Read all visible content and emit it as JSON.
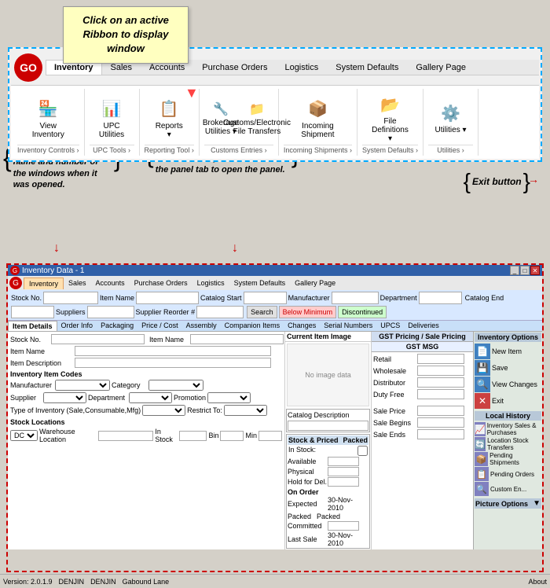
{
  "tooltip": {
    "text": "Click on an active Ribbon to display window"
  },
  "ribbon": {
    "tabs": [
      "Inventory",
      "Sales",
      "Accounts",
      "Purchase Orders",
      "Logistics",
      "System Defaults",
      "Gallery Page"
    ],
    "active_tab": "Inventory",
    "groups": [
      {
        "label": "Inventory Controls",
        "buttons": [
          {
            "label": "View Inventory",
            "icon": "🏪"
          }
        ]
      },
      {
        "label": "UPC Tools",
        "buttons": [
          {
            "label": "UPC Utilities",
            "icon": "📊"
          }
        ]
      },
      {
        "label": "Reporting Tool",
        "buttons": [
          {
            "label": "Reports ▾",
            "icon": "📋"
          }
        ]
      },
      {
        "label": "Customs Entries",
        "buttons": [
          {
            "label": "Brokerage Utilities ▾",
            "icon": "🔧"
          },
          {
            "label": "Customs/Electronic File Transfers",
            "icon": "📁"
          }
        ]
      },
      {
        "label": "Incoming Shipments",
        "buttons": [
          {
            "label": "Incoming Shipment",
            "icon": "📦"
          }
        ]
      },
      {
        "label": "System Defaults",
        "buttons": [
          {
            "label": "File Definitions ▾",
            "icon": "📂"
          }
        ]
      },
      {
        "label": "Utilities",
        "buttons": [
          {
            "label": "Utilities ▾",
            "icon": "⚙️"
          }
        ]
      }
    ]
  },
  "annotations": {
    "left": "Windows displays the name and number of the windows when it was opened.",
    "middle": "Panel – All of the panels are hidden. Place your cursor on the panel tab to open the panel.",
    "right": "Exit button"
  },
  "main_window": {
    "title": "Inventory Data - 1",
    "ribbon_tabs": [
      "Inventory",
      "Sales",
      "Accounts",
      "Purchase Orders",
      "Logistics",
      "System Defaults",
      "Gallery Page"
    ],
    "active_ribbon_tab": "Inventory",
    "search_fields": [
      {
        "label": "Stock No.",
        "value": ""
      },
      {
        "label": "Item Name",
        "value": ""
      },
      {
        "label": "Catalog Start",
        "value": ""
      },
      {
        "label": "Manufacturer",
        "value": ""
      },
      {
        "label": "Department",
        "value": ""
      },
      {
        "label": "Catalog End",
        "value": ""
      },
      {
        "label": "Suppliers",
        "value": ""
      },
      {
        "label": "Supplier Reorder #",
        "value": ""
      }
    ],
    "panel_tabs": [
      "Item Details",
      "Order Info",
      "Packaging",
      "Price / Cost",
      "Assembly",
      "Companion Items",
      "Changes",
      "Serial Numbers",
      "UPCS",
      "Deliveries"
    ],
    "active_panel_tab": "Item Details",
    "form_fields": {
      "stock_no": "",
      "item_name": "",
      "item_description": "",
      "manufacturer": "",
      "category": "",
      "supplier": "",
      "department": "",
      "promotion": "",
      "type_of_inventory": "Sale,Consumable,Mfg",
      "restrict_to": "",
      "stock_locations": {
        "dc": "DC",
        "warehouse_location": "",
        "in_stock": "",
        "bin": "",
        "min": ""
      }
    },
    "image_section": {
      "placeholder": "No image data",
      "catalog_description": "Catalog Description"
    },
    "stock_info": {
      "header": "Stock & Price",
      "packed_label": "Packed",
      "in_stock": "In Stock:",
      "available": "Available",
      "physical": "Physical",
      "hold_for_del": "Hold for Del.",
      "on_order": "On Order",
      "expected": "Expected",
      "expected_date": "30-Nov-2010",
      "packed_field": "Packed",
      "committed": "Committed",
      "last_sale": "Last Sale",
      "last_sale_date": "30-Nov-2010"
    },
    "gst_pricing": {
      "header": "GST Pricing / Sale Pricing",
      "subheader": "GST MSG",
      "fields": [
        "Retail",
        "Wholesale",
        "Distributor",
        "Duty Free",
        "Sale Price",
        "Sale Begins",
        "Sale Ends"
      ]
    },
    "sidebar_inventory": {
      "label": "Inventory Options",
      "buttons": [
        {
          "label": "New Item",
          "icon": "📄",
          "color": "#4080c0"
        },
        {
          "label": "Save",
          "icon": "💾",
          "color": "#4080c0"
        },
        {
          "label": "View Changes",
          "icon": "🔍",
          "color": "#4080c0"
        },
        {
          "label": "Exit",
          "icon": "❌",
          "color": "#cc0000"
        }
      ],
      "local_history_label": "Local History",
      "local_history_buttons": [
        {
          "label": "Inventory Sales & Purchases",
          "icon": "📈"
        },
        {
          "label": "Location Stock Transfers",
          "icon": "🔄"
        },
        {
          "label": "Pending Shipments",
          "icon": "📦"
        },
        {
          "label": "Pending Orders",
          "icon": "📋"
        },
        {
          "label": "Custom En...",
          "icon": "🔧"
        }
      ],
      "picture_options_label": "Picture Options"
    }
  },
  "status_bar": {
    "version": "Version: 2.0.1.9",
    "db1": "DENJIN",
    "db2": "DENJIN",
    "lane": "Gabound Lane"
  }
}
